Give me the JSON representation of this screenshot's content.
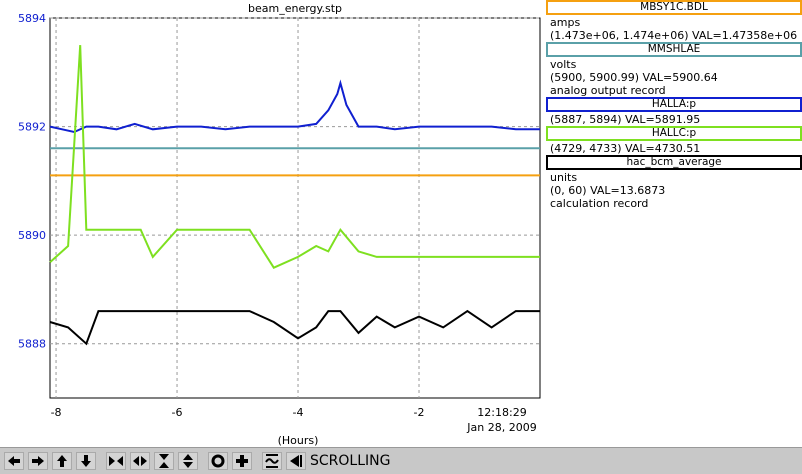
{
  "plot_title": "beam_energy.stp",
  "y_ticks": [
    "5894",
    "5892",
    "5890",
    "5888"
  ],
  "x_ticks": [
    "-8",
    "-6",
    "-4",
    "-2"
  ],
  "time_label": "12:18:29",
  "date_label": "Jan 28, 2009",
  "x_axis_label": "(Hours)",
  "legend": [
    {
      "name": "MBSY1C.BDL",
      "color": "#f5a010",
      "lines": [
        "amps",
        "(1.473e+06, 1.474e+06)  VAL=1.47358e+06"
      ]
    },
    {
      "name": "MMSHLAE",
      "color": "#5aa0a8",
      "lines": [
        "volts",
        "(5900, 5900.99) VAL=5900.64",
        "analog output record"
      ]
    },
    {
      "name": "HALLA:p",
      "color": "#1020d0",
      "lines": [
        "(5887, 5894) VAL=5891.95"
      ]
    },
    {
      "name": "HALLC:p",
      "color": "#7ee020",
      "lines": [
        "(4729, 4733) VAL=4730.51"
      ]
    },
    {
      "name": "hac_bcm_average",
      "color": "#000000",
      "lines": [
        "units",
        "(0, 60) VAL=13.6873",
        "calculation record"
      ]
    }
  ],
  "chart_data": {
    "type": "line",
    "x_unit": "Hours",
    "xlim": [
      -8.1,
      0.0
    ],
    "ylim": [
      5887.0,
      5894.0
    ],
    "y_tick_values": [
      5894,
      5892,
      5890,
      5888
    ],
    "x_tick_values": [
      -8,
      -6,
      -4,
      -2
    ],
    "grid": true,
    "series": [
      {
        "name": "MBSY1C.BDL",
        "color": "#f5a010",
        "x": [
          -8.1,
          0.0
        ],
        "y": [
          5891.1,
          5891.1
        ]
      },
      {
        "name": "MMSHLAE",
        "color": "#5aa0a8",
        "x": [
          -8.1,
          0.0
        ],
        "y": [
          5891.6,
          5891.6
        ]
      },
      {
        "name": "HALLA:p",
        "color": "#1020d0",
        "x": [
          -8.1,
          -7.9,
          -7.7,
          -7.5,
          -7.3,
          -7.0,
          -6.7,
          -6.4,
          -6.0,
          -5.6,
          -5.2,
          -4.8,
          -4.4,
          -4.0,
          -3.7,
          -3.5,
          -3.35,
          -3.3,
          -3.2,
          -3.0,
          -2.7,
          -2.4,
          -2.0,
          -1.6,
          -1.2,
          -0.8,
          -0.4,
          0.0
        ],
        "y": [
          5892.0,
          5891.95,
          5891.9,
          5892.0,
          5892.0,
          5891.95,
          5892.05,
          5891.95,
          5892.0,
          5892.0,
          5891.95,
          5892.0,
          5892.0,
          5892.0,
          5892.05,
          5892.3,
          5892.6,
          5892.8,
          5892.4,
          5892.0,
          5892.0,
          5891.95,
          5892.0,
          5892.0,
          5892.0,
          5892.0,
          5891.95,
          5891.95
        ]
      },
      {
        "name": "HALLC:p",
        "color": "#7ee020",
        "x": [
          -8.1,
          -7.8,
          -7.6,
          -7.5,
          -7.3,
          -7.0,
          -6.6,
          -6.4,
          -6.0,
          -5.6,
          -5.2,
          -4.8,
          -4.4,
          -4.0,
          -3.7,
          -3.5,
          -3.3,
          -3.0,
          -2.7,
          -2.4,
          -2.0,
          -1.6,
          -1.2,
          -0.8,
          -0.4,
          0.0
        ],
        "y": [
          5889.5,
          5889.8,
          5893.5,
          5890.1,
          5890.1,
          5890.1,
          5890.1,
          5889.6,
          5890.1,
          5890.1,
          5890.1,
          5890.1,
          5889.4,
          5889.6,
          5889.8,
          5889.7,
          5890.1,
          5889.7,
          5889.6,
          5889.6,
          5889.6,
          5889.6,
          5889.6,
          5889.6,
          5889.6,
          5889.6
        ]
      },
      {
        "name": "hac_bcm_average",
        "color": "#000000",
        "x": [
          -8.1,
          -7.8,
          -7.5,
          -7.3,
          -7.0,
          -6.7,
          -6.4,
          -6.0,
          -5.6,
          -5.2,
          -4.8,
          -4.4,
          -4.0,
          -3.7,
          -3.5,
          -3.3,
          -3.0,
          -2.7,
          -2.4,
          -2.0,
          -1.6,
          -1.2,
          -0.8,
          -0.4,
          0.0
        ],
        "y": [
          5888.4,
          5888.3,
          5888.0,
          5888.6,
          5888.6,
          5888.6,
          5888.6,
          5888.6,
          5888.6,
          5888.6,
          5888.6,
          5888.4,
          5888.1,
          5888.3,
          5888.6,
          5888.6,
          5888.2,
          5888.5,
          5888.3,
          5888.5,
          5888.3,
          5888.6,
          5888.3,
          5888.6,
          5888.6
        ]
      }
    ]
  },
  "toolbar": {
    "buttons": [
      "arrow-left-icon",
      "arrow-right-icon",
      "arrow-up-icon",
      "arrow-down-icon",
      "zoom-in-horizontal-icon",
      "zoom-out-horizontal-icon",
      "zoom-in-vertical-icon",
      "zoom-out-vertical-icon",
      "record-icon",
      "add-icon",
      "auto-scale-icon",
      "export-icon"
    ],
    "status": "SCROLLING"
  }
}
